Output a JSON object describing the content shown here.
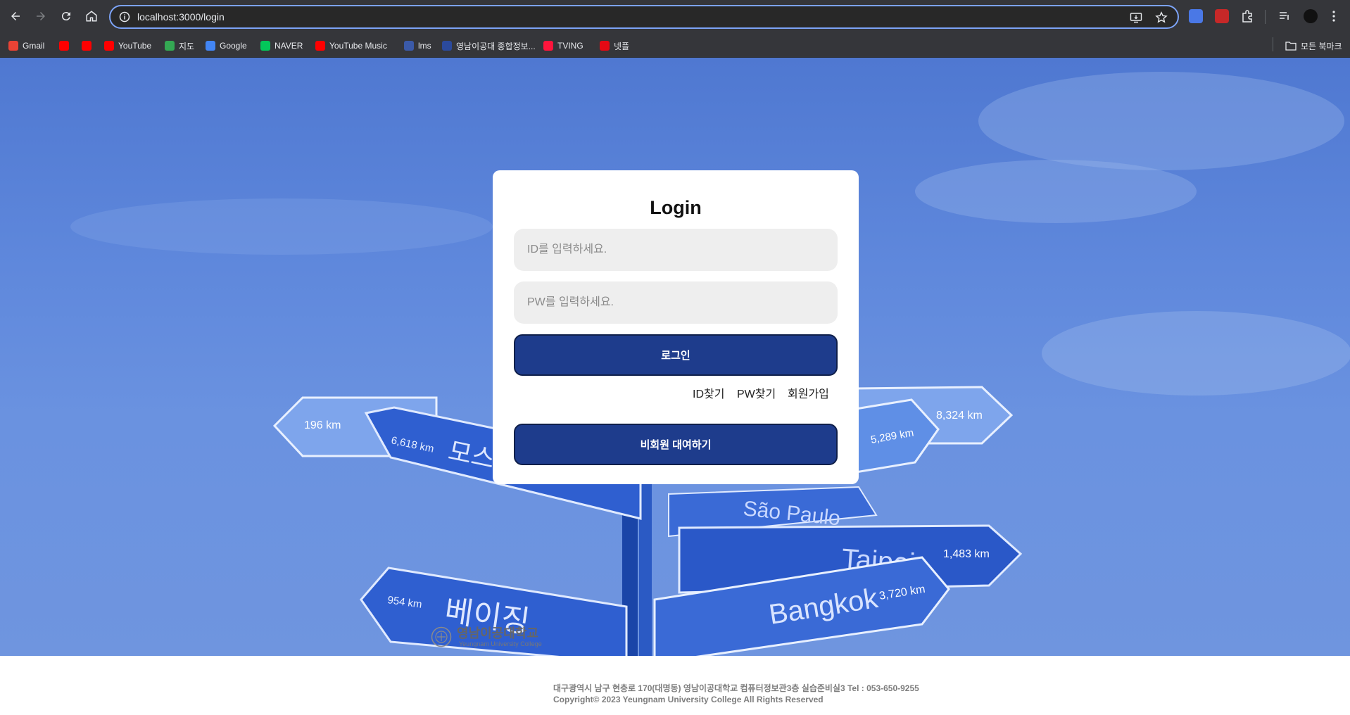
{
  "browser": {
    "url": "localhost:3000/login",
    "bookmarks": [
      {
        "label": "Gmail",
        "icon": "gmail-icon",
        "color": "#ea4335"
      },
      {
        "label": "",
        "icon": "youtube-icon",
        "color": "#ff0000"
      },
      {
        "label": "",
        "icon": "youtube-icon",
        "color": "#ff0000"
      },
      {
        "label": "YouTube",
        "icon": "youtube-icon",
        "color": "#ff0000"
      },
      {
        "label": "지도",
        "icon": "maps-icon",
        "color": "#34a853"
      },
      {
        "label": "Google",
        "icon": "google-icon",
        "color": "#4285f4"
      },
      {
        "label": "NAVER",
        "icon": "naver-icon",
        "color": "#03c75a"
      },
      {
        "label": "YouTube Music",
        "icon": "youtube-music-icon",
        "color": "#ff0000"
      },
      {
        "label": "lms",
        "icon": "lms-icon",
        "color": "#3b5aa8"
      },
      {
        "label": "영남이공대 종합정보...",
        "icon": "ync-icon",
        "color": "#2b4a9c"
      },
      {
        "label": "TVING",
        "icon": "tving-icon",
        "color": "#ff153c"
      },
      {
        "label": "넷플",
        "icon": "netflix-icon",
        "color": "#e50914"
      }
    ],
    "all_bookmarks_label": "모든 북마크"
  },
  "login": {
    "title": "Login",
    "id_placeholder": "ID를 입력하세요.",
    "pw_placeholder": "PW를 입력하세요.",
    "login_button": "로그인",
    "find_id": "ID찾기",
    "find_pw": "PW찾기",
    "signup": "회원가입",
    "guest_button": "비회원 대여하기"
  },
  "signposts": [
    "196 km",
    "6,618 km",
    "모스",
    "8,324 km",
    "5,289 km",
    "São Paulo",
    "Taipei",
    "1,483 km",
    "954 km",
    "베이징",
    "Bangkok",
    "3,720 km"
  ],
  "footer": {
    "logo_korean": "영남이공대학교",
    "logo_english": "Yeungnam University College",
    "address": "대구광역시 남구 현충로 170(대명동) 영남이공대학교 컴퓨터정보관3층 실습준비실3 Tel : 053-650-9255",
    "copyright": "Copyright© 2023 Yeungnam University College All Rights Reserved"
  },
  "colors": {
    "button": "#1e3c8c",
    "sky": "#5f88dc",
    "sign": "#2f5fd0"
  }
}
